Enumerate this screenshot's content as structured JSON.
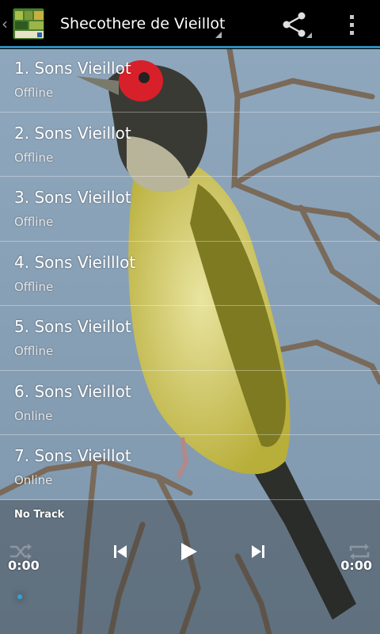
{
  "app": {
    "title": "Shecothere de Vieillot",
    "accent": "#2b8bb8"
  },
  "actionbar": {
    "icons": [
      "up-caret-icon",
      "app-icon",
      "share-icon",
      "overflow-menu-icon"
    ]
  },
  "tracks": [
    {
      "label": "1. Sons Vieillot",
      "status": "Offline"
    },
    {
      "label": "2. Sons Vieillot",
      "status": "Offline"
    },
    {
      "label": "3. Sons Vieillot",
      "status": "Offline"
    },
    {
      "label": "4. Sons Vieilllot",
      "status": "Offline"
    },
    {
      "label": "5. Sons Vieillot",
      "status": "Offline"
    },
    {
      "label": "6. Sons Vieillot",
      "status": "Online"
    },
    {
      "label": "7. Sons Vieillot",
      "status": "Online"
    }
  ],
  "player": {
    "now_playing": "No Track",
    "elapsed": "0:00",
    "duration": "0:00",
    "progress": 0,
    "seek_color": "#27a7e0",
    "icons": [
      "shuffle-icon",
      "previous-icon",
      "play-icon",
      "next-icon",
      "repeat-icon"
    ]
  }
}
